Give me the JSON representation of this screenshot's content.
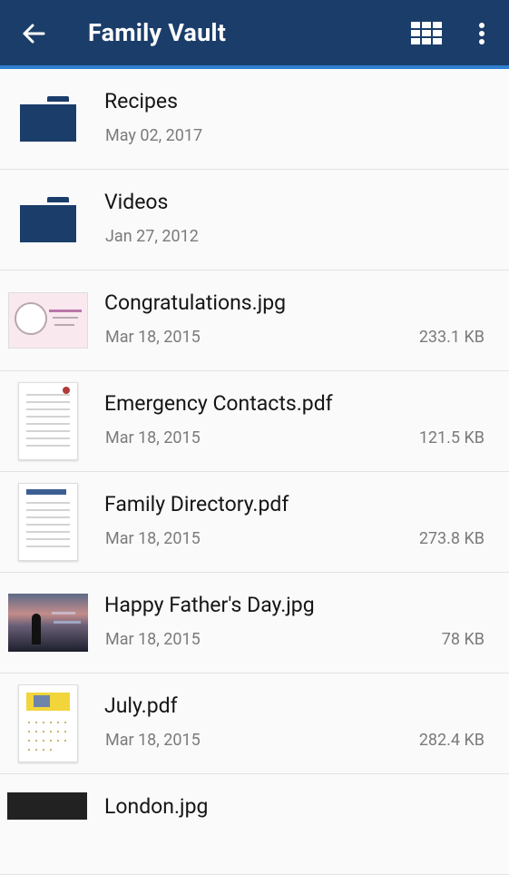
{
  "appbar": {
    "title": "Family Vault",
    "back_icon": "arrow-left-icon",
    "grid_icon": "grid-view-icon",
    "more_icon": "more-vert-icon",
    "colors": {
      "bar": "#1b3d6a",
      "underline": "#2f7fd0"
    }
  },
  "items": [
    {
      "name": "Recipes",
      "date": "May 02, 2017",
      "size": "",
      "thumb": "folder-icon"
    },
    {
      "name": "Videos",
      "date": "Jan 27, 2012",
      "size": "",
      "thumb": "folder-icon"
    },
    {
      "name": "Congratulations.jpg",
      "date": "Mar 18, 2015",
      "size": "233.1 KB",
      "thumb": "image-thumbnail"
    },
    {
      "name": "Emergency Contacts.pdf",
      "date": "Mar 18, 2015",
      "size": "121.5 KB",
      "thumb": "pdf-thumbnail"
    },
    {
      "name": "Family Directory.pdf",
      "date": "Mar 18, 2015",
      "size": "273.8 KB",
      "thumb": "pdf-thumbnail"
    },
    {
      "name": "Happy Father's Day.jpg",
      "date": "Mar 18, 2015",
      "size": "78 KB",
      "thumb": "image-thumbnail"
    },
    {
      "name": "July.pdf",
      "date": "Mar 18, 2015",
      "size": "282.4 KB",
      "thumb": "pdf-thumbnail"
    },
    {
      "name": "London.jpg",
      "date": "",
      "size": "",
      "thumb": "image-thumbnail"
    }
  ]
}
